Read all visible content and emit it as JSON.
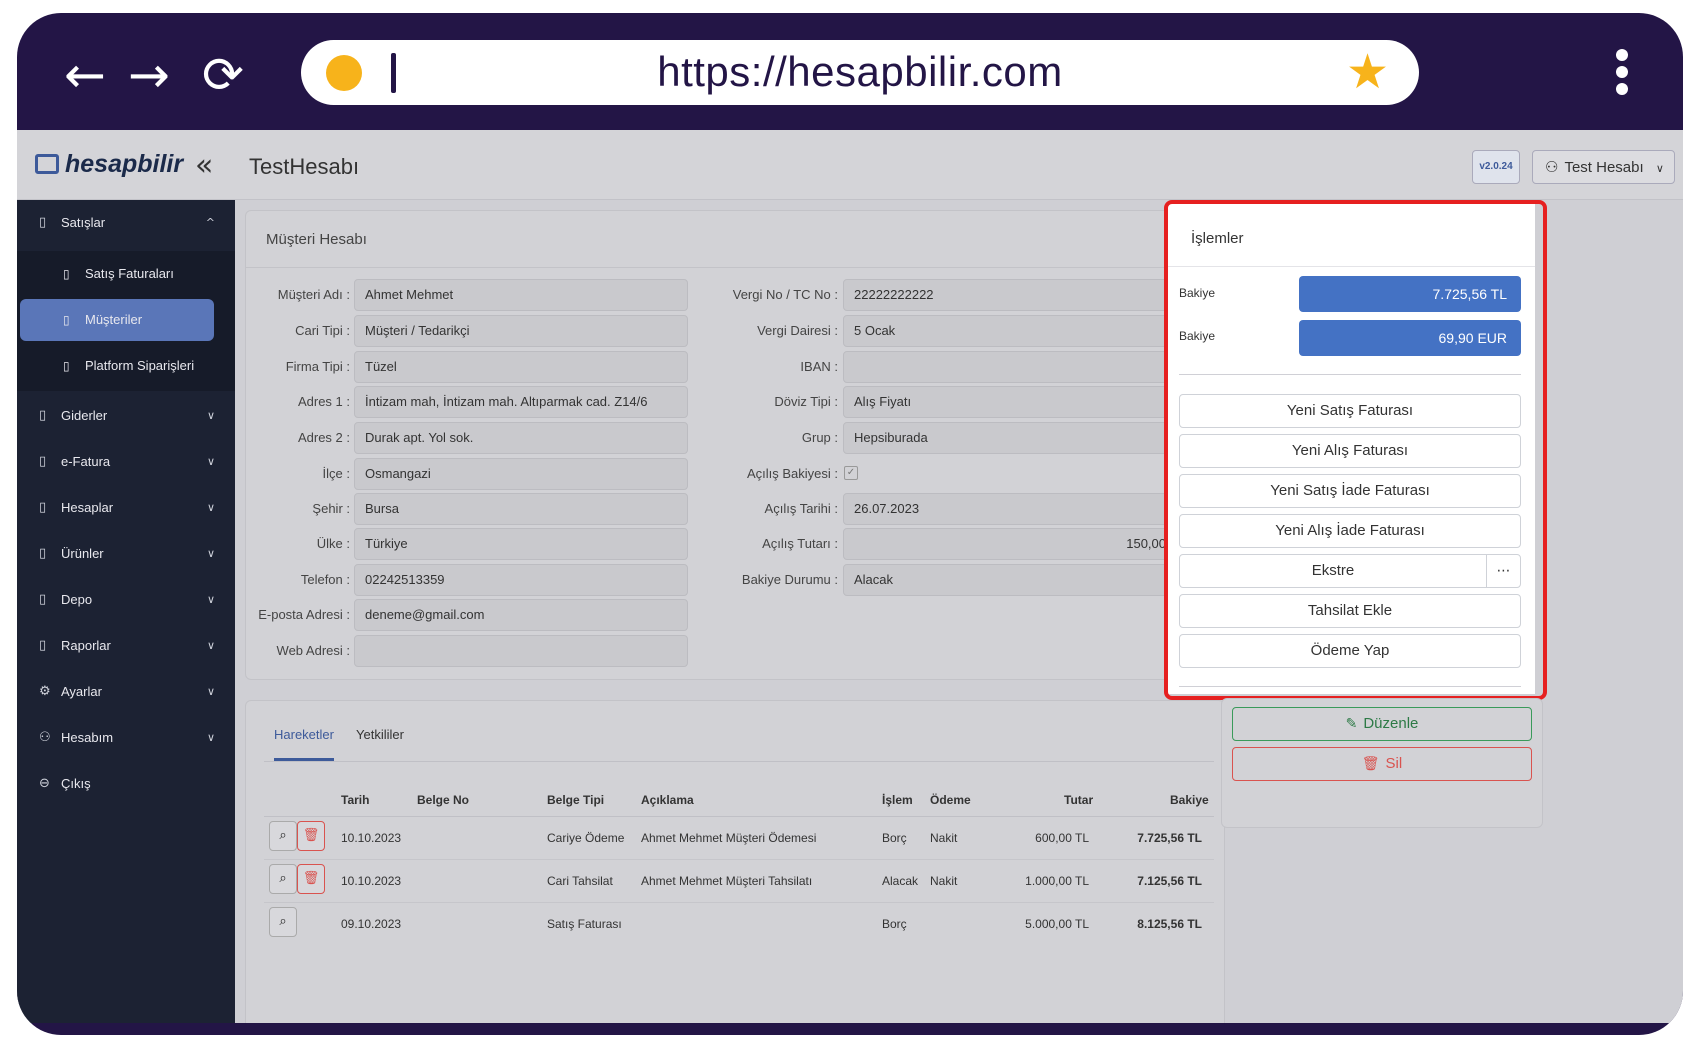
{
  "browser": {
    "back_icon": "←",
    "forward_icon": "→",
    "reload_icon": "⟳",
    "url": "https://hesapbilir.com",
    "star_icon": "★"
  },
  "header": {
    "logo_text": "hesapbilir",
    "collapse_icon": "«",
    "page_title": "TestHesabı",
    "version": "v2.0.24",
    "user_label": "Test Hesabı",
    "user_icon": "⚇",
    "user_chevron": "∨"
  },
  "sidebar": {
    "items": [
      {
        "label": "Satışlar",
        "icon": "▯",
        "chevron": "^"
      },
      {
        "label": "Giderler",
        "icon": "▯",
        "chevron": "∨"
      },
      {
        "label": "e-Fatura",
        "icon": "▯",
        "chevron": "∨"
      },
      {
        "label": "Hesaplar",
        "icon": "▯",
        "chevron": "∨"
      },
      {
        "label": "Ürünler",
        "icon": "▯",
        "chevron": "∨"
      },
      {
        "label": "Depo",
        "icon": "▯",
        "chevron": "∨"
      },
      {
        "label": "Raporlar",
        "icon": "▯",
        "chevron": "∨"
      },
      {
        "label": "Ayarlar",
        "icon": "⚙",
        "chevron": "∨"
      },
      {
        "label": "Hesabım",
        "icon": "⚇",
        "chevron": "∨"
      },
      {
        "label": "Çıkış",
        "icon": "⊖",
        "chevron": ""
      }
    ],
    "sub_items": [
      {
        "label": "Satış Faturaları",
        "icon": "▯"
      },
      {
        "label": "Müşteriler",
        "icon": "▯"
      },
      {
        "label": "Platform Siparişleri",
        "icon": "▯"
      }
    ]
  },
  "customer": {
    "title": "Müşteri Hesabı",
    "left_fields": [
      {
        "label": "Müşteri Adı :",
        "value": "Ahmet Mehmet"
      },
      {
        "label": "Cari Tipi :",
        "value": "Müşteri / Tedarikçi"
      },
      {
        "label": "Firma Tipi :",
        "value": "Tüzel"
      },
      {
        "label": "Adres 1 :",
        "value": "İntizam mah, İntizam mah. Altıparmak cad. Z14/6"
      },
      {
        "label": "Adres 2 :",
        "value": "Durak apt. Yol sok."
      },
      {
        "label": "İlçe :",
        "value": "Osmangazi"
      },
      {
        "label": "Şehir :",
        "value": "Bursa"
      },
      {
        "label": "Ülke :",
        "value": "Türkiye"
      },
      {
        "label": "Telefon :",
        "value": "02242513359"
      },
      {
        "label": "E-posta Adresi :",
        "value": "deneme@gmail.com"
      },
      {
        "label": "Web Adresi :",
        "value": ""
      }
    ],
    "right_fields": [
      {
        "label": "Vergi No / TC No :",
        "value": "22222222222"
      },
      {
        "label": "Vergi Dairesi :",
        "value": "5 Ocak"
      },
      {
        "label": "IBAN :",
        "value": ""
      },
      {
        "label": "Döviz Tipi :",
        "value": "Alış Fiyatı"
      },
      {
        "label": "Grup :",
        "value": "Hepsiburada"
      },
      {
        "label": "Açılış Bakiyesi :",
        "value": "✓"
      },
      {
        "label": "Açılış Tarihi :",
        "value": "26.07.2023"
      },
      {
        "label": "Açılış Tutarı :",
        "value": "150,00"
      },
      {
        "label": "Bakiye Durumu :",
        "value": "Alacak"
      }
    ]
  },
  "actions": {
    "title": "İşlemler",
    "balances": [
      {
        "label": "Bakiye",
        "value": "7.725,56 TL"
      },
      {
        "label": "Bakiye",
        "value": "69,90 EUR"
      }
    ],
    "buttons": [
      "Yeni Satış Faturası",
      "Yeni Alış Faturası",
      "Yeni Satış İade Faturası",
      "Yeni Alış İade Faturası",
      "Ekstre",
      "Tahsilat Ekle",
      "Ödeme Yap"
    ],
    "more_icon": "⋯",
    "edit_label": "Düzenle",
    "edit_icon": "✎",
    "delete_label": "Sil",
    "delete_icon": "🗑"
  },
  "tabs": [
    "Hareketler",
    "Yetkililer"
  ],
  "table": {
    "headers": [
      "Tarih",
      "Belge No",
      "Belge Tipi",
      "Açıklama",
      "İşlem",
      "Ödeme",
      "Tutar",
      "Bakiye"
    ],
    "search_icon": "⌕",
    "trash_icon": "🗑",
    "rows": [
      {
        "tarih": "10.10.2023",
        "belge_no": "",
        "belge_tipi": "Cariye Ödeme",
        "aciklama": "Ahmet Mehmet Müşteri Ödemesi",
        "islem": "Borç",
        "odeme": "Nakit",
        "tutar": "600,00 TL",
        "bakiye": "7.725,56 TL"
      },
      {
        "tarih": "10.10.2023",
        "belge_no": "",
        "belge_tipi": "Cari Tahsilat",
        "aciklama": "Ahmet Mehmet Müşteri Tahsilatı",
        "islem": "Alacak",
        "odeme": "Nakit",
        "tutar": "1.000,00 TL",
        "bakiye": "7.125,56 TL"
      },
      {
        "tarih": "09.10.2023",
        "belge_no": "",
        "belge_tipi": "Satış Faturası",
        "aciklama": "",
        "islem": "Borç",
        "odeme": "",
        "tutar": "5.000,00 TL",
        "bakiye": "8.125,56 TL"
      }
    ]
  },
  "colors": {
    "frame": "#231546",
    "accent": "#4472c4",
    "highlight": "#e62020",
    "url_dot": "#f7b31b"
  }
}
